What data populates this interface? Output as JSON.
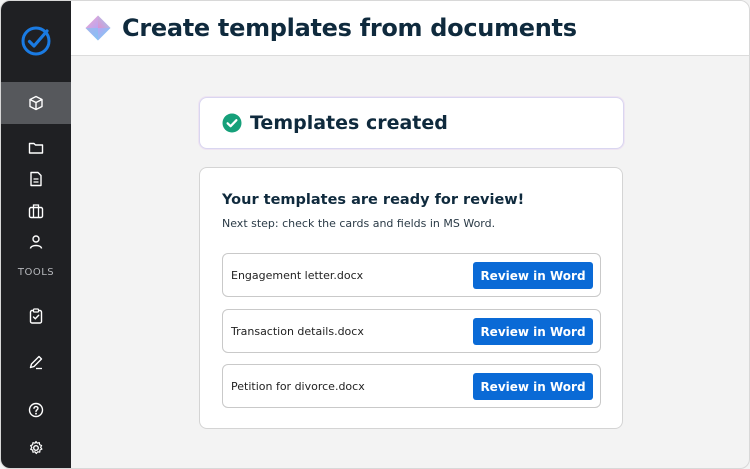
{
  "header": {
    "title": "Create templates from documents",
    "icon": "gem-logo-icon"
  },
  "sidebar": {
    "logo": "checkmark-circle-logo",
    "tools_label": "TOOLS",
    "items": [
      {
        "icon": "cube-icon",
        "active": true
      },
      {
        "icon": "folder-icon"
      },
      {
        "icon": "document-icon"
      },
      {
        "icon": "briefcase-icon"
      },
      {
        "icon": "person-icon"
      },
      {
        "icon": "clipboard-check-icon"
      },
      {
        "icon": "pen-icon"
      },
      {
        "icon": "help-icon"
      },
      {
        "icon": "gear-icon"
      }
    ],
    "colors": {
      "background": "#1f2023",
      "active": "#56585c",
      "accent": "#1a7be3"
    }
  },
  "status": {
    "text": "Templates created",
    "icon": "check-circle-icon",
    "color": "#16a07a"
  },
  "main": {
    "heading": "Your templates are ready for review!",
    "subtext": "Next step: check the cards and fields in MS Word.",
    "files": [
      {
        "name": "Engagement letter.docx",
        "action": "Review in Word"
      },
      {
        "name": "Transaction details.docx",
        "action": "Review in Word"
      },
      {
        "name": "Petition for divorce.docx",
        "action": "Review in Word"
      }
    ],
    "button_color": "#0a6ad6"
  }
}
